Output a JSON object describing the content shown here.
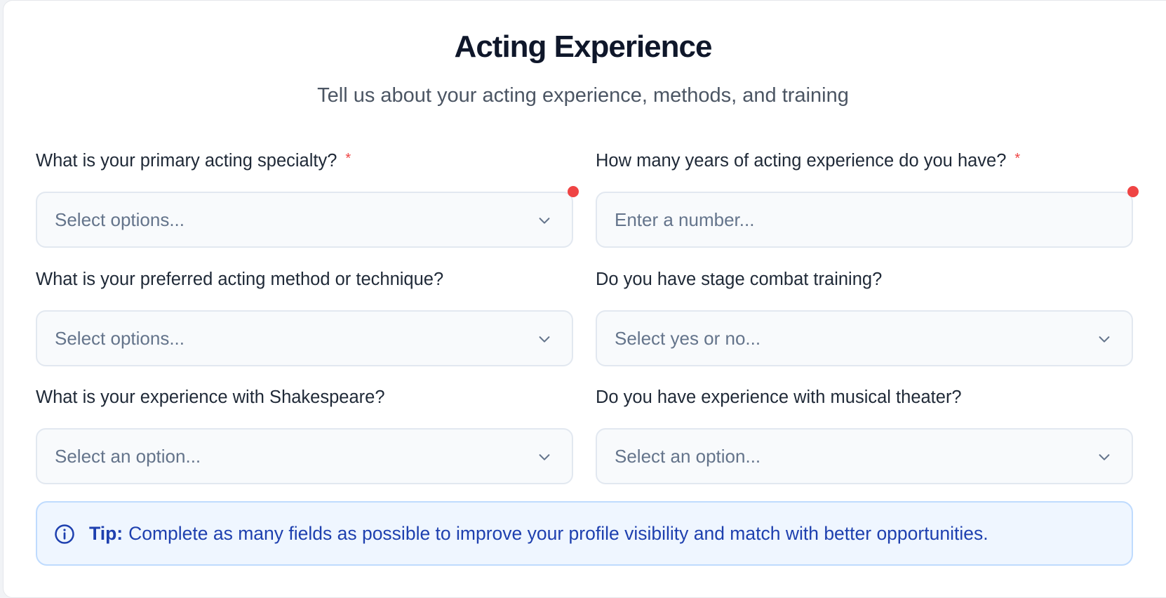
{
  "header": {
    "title": "Acting Experience",
    "subtitle": "Tell us about your acting experience, methods, and training"
  },
  "fields": {
    "specialty": {
      "label": "What is your primary acting specialty?",
      "required_mark": "*",
      "placeholder": "Select options...",
      "icon": "chevron-down-icon"
    },
    "years": {
      "label": "How many years of acting experience do you have?",
      "required_mark": "*",
      "placeholder": "Enter a number..."
    },
    "method": {
      "label": "What is your preferred acting method or technique?",
      "placeholder": "Select options...",
      "icon": "chevron-down-icon"
    },
    "combat": {
      "label": "Do you have stage combat training?",
      "placeholder": "Select yes or no...",
      "icon": "chevron-down-icon"
    },
    "shakespeare": {
      "label": "What is your experience with Shakespeare?",
      "placeholder": "Select an option...",
      "icon": "chevron-down-icon"
    },
    "musical": {
      "label": "Do you have experience with musical theater?",
      "placeholder": "Select an option...",
      "icon": "chevron-down-icon"
    }
  },
  "tip": {
    "icon": "info-icon",
    "strong": "Tip:",
    "text": "Complete as many fields as possible to improve your profile visibility and match with better opportunities."
  },
  "colors": {
    "required": "#ef4444",
    "tip_text": "#1e40af",
    "tip_bg": "#eff6ff",
    "field_bg": "#f8fafc",
    "field_border": "#e2e8f0"
  }
}
